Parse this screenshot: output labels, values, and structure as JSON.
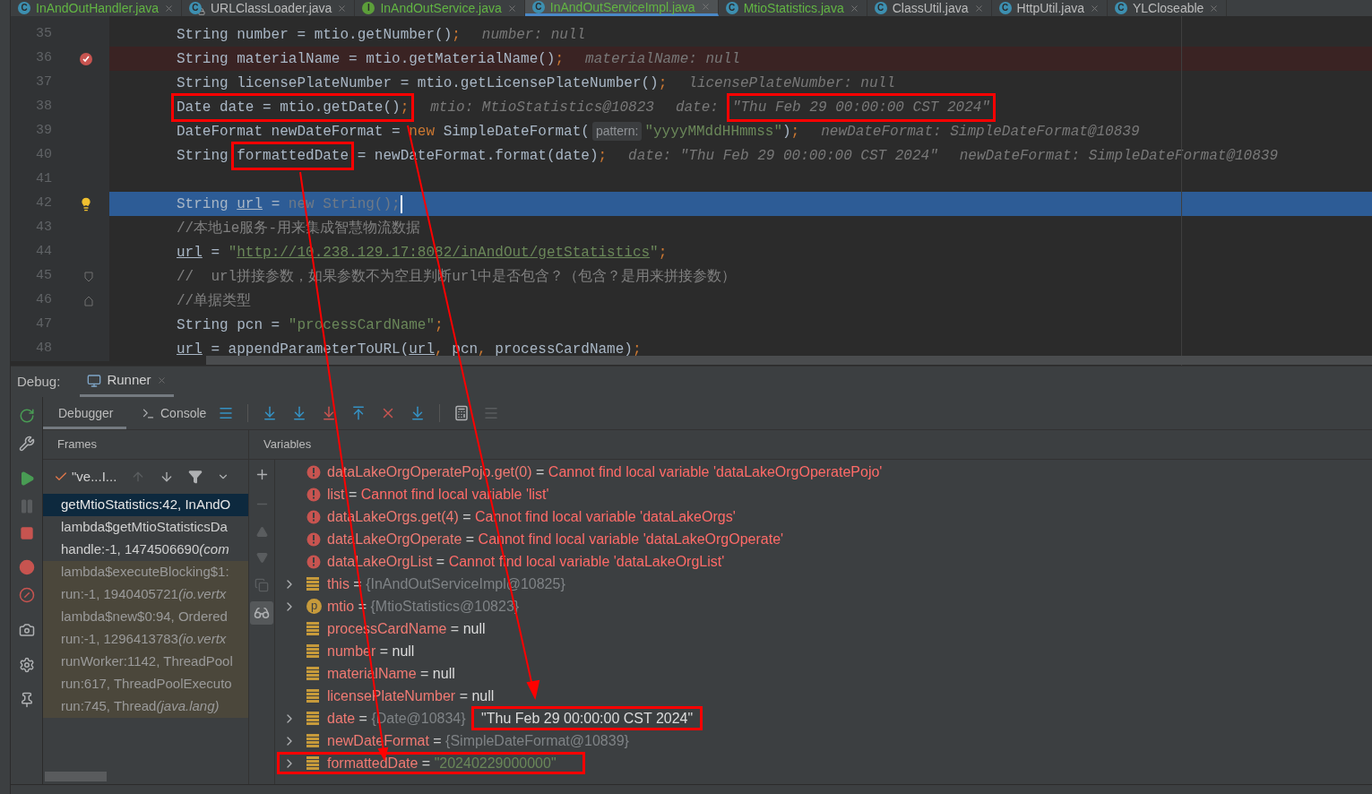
{
  "editor_tabs": [
    {
      "label": "InAndOutHandler.java",
      "kind": "class",
      "icon_letter": "C",
      "modified": true,
      "selected": false
    },
    {
      "label": "URLClassLoader.java",
      "kind": "locked",
      "icon_letter": "C",
      "modified": false,
      "selected": false
    },
    {
      "label": "InAndOutService.java",
      "kind": "interface",
      "icon_letter": "I",
      "modified": true,
      "selected": false
    },
    {
      "label": "InAndOutServiceImpl.java",
      "kind": "class",
      "icon_letter": "C",
      "modified": true,
      "selected": true
    },
    {
      "label": "MtioStatistics.java",
      "kind": "class",
      "icon_letter": "C",
      "modified": true,
      "selected": false
    },
    {
      "label": "ClassUtil.java",
      "kind": "class",
      "icon_letter": "C",
      "modified": false,
      "selected": false
    },
    {
      "label": "HttpUtil.java",
      "kind": "class",
      "icon_letter": "C",
      "modified": false,
      "selected": false
    },
    {
      "label": "YLCloseable",
      "kind": "class",
      "icon_letter": "C",
      "modified": false,
      "selected": false
    }
  ],
  "code_lines": [
    {
      "number": "35",
      "kind": "plain",
      "caret": false,
      "segments": [
        {
          "kind": "code",
          "text": "String number = mtio.getNumber()"
        },
        {
          "kind": "keyword",
          "text": ";"
        },
        {
          "kind": "hint",
          "text": "number: null"
        }
      ]
    },
    {
      "number": "36",
      "kind": "breakpoint",
      "caret": false,
      "segments": [
        {
          "kind": "code",
          "text": "String materialName = mtio.getMaterialName()"
        },
        {
          "kind": "keyword",
          "text": ";"
        },
        {
          "kind": "hint",
          "text": "materialName: null"
        }
      ]
    },
    {
      "number": "37",
      "kind": "plain",
      "caret": false,
      "segments": [
        {
          "kind": "code",
          "text": "String licensePlateNumber = mtio.getLicensePlateNumber()"
        },
        {
          "kind": "keyword",
          "text": ";"
        },
        {
          "kind": "hint",
          "text": "licensePlateNumber: null"
        }
      ]
    },
    {
      "number": "38",
      "kind": "plain",
      "caret": false,
      "segments": [
        {
          "kind": "code",
          "text": "Date date = mtio.getDate()",
          "boxed": true
        },
        {
          "kind": "keyword",
          "text": ";",
          "boxed": true
        },
        {
          "kind": "hint",
          "text": "mtio: MtioStatistics@10823"
        },
        {
          "kind": "hint",
          "text": "date:"
        },
        {
          "kind": "hint_cont",
          "text": "\"Thu Feb 29 00:00:00 CST 2024\"",
          "boxed": true
        }
      ]
    },
    {
      "number": "39",
      "kind": "plain",
      "caret": false,
      "segments": [
        {
          "kind": "code",
          "text": "DateFormat newDateFormat = "
        },
        {
          "kind": "keyword",
          "text": "new"
        },
        {
          "kind": "code",
          "text": " SimpleDateFormat("
        },
        {
          "kind": "param_hint",
          "text": "pattern:"
        },
        {
          "kind": "string",
          "text": "\"yyyyMMddHHmmss\""
        },
        {
          "kind": "code",
          "text": ")"
        },
        {
          "kind": "keyword",
          "text": ";"
        },
        {
          "kind": "hint",
          "text": "newDateFormat: SimpleDateFormat@10839"
        }
      ]
    },
    {
      "number": "40",
      "kind": "plain",
      "caret": false,
      "segments": [
        {
          "kind": "code",
          "text": "String "
        },
        {
          "kind": "code",
          "text": "formattedDate",
          "boxed": true
        },
        {
          "kind": "code",
          "text": " = newDateFormat.format(date)"
        },
        {
          "kind": "keyword",
          "text": ";"
        },
        {
          "kind": "hint",
          "text": "date: \"Thu Feb 29 00:00:00 CST 2024\""
        },
        {
          "kind": "hint",
          "text": "newDateFormat: SimpleDateFormat@10839"
        }
      ]
    },
    {
      "number": "41",
      "kind": "plain",
      "caret": false
    },
    {
      "number": "42",
      "kind": "current",
      "caret": true,
      "segments": [
        {
          "kind": "code",
          "text": "String "
        },
        {
          "kind": "underlined",
          "text": "url"
        },
        {
          "kind": "code",
          "text": " = "
        },
        {
          "kind": "dim",
          "text": "new String();"
        }
      ]
    },
    {
      "number": "43",
      "kind": "plain",
      "caret": false,
      "segments": [
        {
          "kind": "comment",
          "text": "//本地ie服务-用来集成智慧物流数据"
        }
      ]
    },
    {
      "number": "44",
      "kind": "plain",
      "caret": false,
      "segments": [
        {
          "kind": "underlined",
          "text": "url"
        },
        {
          "kind": "code",
          "text": " = "
        },
        {
          "kind": "string",
          "text": "\""
        },
        {
          "kind": "link",
          "text": "http://10.238.129.17:8082/inAndOut/getStatistics"
        },
        {
          "kind": "string",
          "text": "\""
        },
        {
          "kind": "keyword",
          "text": ";"
        }
      ]
    },
    {
      "number": "45",
      "kind": "fold_start",
      "caret": false,
      "segments": [
        {
          "kind": "comment",
          "text": "//  url拼接参数，如果参数不为空且判断url中是否包含？（包含？是用来拼接参数）"
        }
      ]
    },
    {
      "number": "46",
      "kind": "fold_end",
      "caret": false,
      "segments": [
        {
          "kind": "comment",
          "text": "//单据类型"
        }
      ]
    },
    {
      "number": "47",
      "kind": "plain",
      "caret": false,
      "segments": [
        {
          "kind": "code",
          "text": "String pcn = "
        },
        {
          "kind": "string",
          "text": "\"processCardName\""
        },
        {
          "kind": "keyword",
          "text": ";"
        }
      ]
    },
    {
      "number": "48",
      "kind": "plain",
      "caret": false,
      "segments": [
        {
          "kind": "underlined",
          "text": "url"
        },
        {
          "kind": "code",
          "text": " = appendParameterToURL("
        },
        {
          "kind": "underlined",
          "text": "url"
        },
        {
          "kind": "keyword",
          "text": ","
        },
        {
          "kind": "code",
          "text": " pcn"
        },
        {
          "kind": "keyword",
          "text": ","
        },
        {
          "kind": "code",
          "text": " processCardName)"
        },
        {
          "kind": "keyword",
          "text": ";"
        }
      ]
    }
  ],
  "debug": {
    "label": "Debug:",
    "session_tab": {
      "label": "Runner",
      "selected": true
    },
    "tabs": [
      {
        "label": "Debugger",
        "selected": true
      },
      {
        "label": "Console",
        "selected": false
      }
    ],
    "frames_title": "Frames",
    "variables_title": "Variables",
    "thread": "\"ve...I...",
    "frames": [
      {
        "text": "getMtioStatistics:42, InAndO",
        "selected": true,
        "library": false
      },
      {
        "text": "lambda$getMtioStatisticsDa",
        "selected": false,
        "library": false
      },
      {
        "text": "handle:-1, 1474506690 ",
        "detail": "(com",
        "selected": false,
        "library": false
      },
      {
        "text": "lambda$executeBlocking$1:",
        "selected": false,
        "library": true
      },
      {
        "text": "run:-1, 1940405721 ",
        "detail": "(io.vertx",
        "selected": false,
        "library": true
      },
      {
        "text": "lambda$new$0:94, Ordered",
        "selected": false,
        "library": true
      },
      {
        "text": "run:-1, 1296413783 ",
        "detail": "(io.vertx",
        "selected": false,
        "library": true
      },
      {
        "text": "runWorker:1142, ThreadPool",
        "selected": false,
        "library": true
      },
      {
        "text": "run:617, ThreadPoolExecuto",
        "selected": false,
        "library": true
      },
      {
        "text": "run:745, Thread ",
        "detail": "(java.lang)",
        "selected": false,
        "library": true
      }
    ],
    "variables": [
      {
        "kind": "error",
        "name": "dataLakeOrgOperatePojo.get(0)",
        "operator": "=",
        "value": "Cannot find local variable 'dataLakeOrgOperatePojo'",
        "expandable": false
      },
      {
        "kind": "error",
        "name": "list",
        "operator": "=",
        "value": "Cannot find local variable 'list'",
        "expandable": false
      },
      {
        "kind": "error",
        "name": "dataLakeOrgs.get(4)",
        "operator": "=",
        "value": "Cannot find local variable 'dataLakeOrgs'",
        "expandable": false
      },
      {
        "kind": "error",
        "name": "dataLakeOrgOperate",
        "operator": "=",
        "value": "Cannot find local variable 'dataLakeOrgOperate'",
        "expandable": false
      },
      {
        "kind": "error",
        "name": "dataLakeOrgList",
        "operator": "=",
        "value": "Cannot find local variable 'dataLakeOrgList'",
        "expandable": false
      },
      {
        "kind": "field",
        "name": "this",
        "operator": "=",
        "ref": "{InAndOutServiceImpl@10825}",
        "expandable": true
      },
      {
        "kind": "param",
        "badge": "p",
        "name": "mtio",
        "operator": "=",
        "ref": "{MtioStatistics@10823}",
        "expandable": true
      },
      {
        "kind": "field",
        "name": "processCardName",
        "operator": "=",
        "value": "null",
        "expandable": false
      },
      {
        "kind": "field",
        "name": "number",
        "operator": "=",
        "value": "null",
        "expandable": false
      },
      {
        "kind": "field",
        "name": "materialName",
        "operator": "=",
        "value": "null",
        "expandable": false
      },
      {
        "kind": "field",
        "name": "licensePlateNumber",
        "operator": "=",
        "value": "null",
        "expandable": false
      },
      {
        "kind": "field",
        "name": "date",
        "operator": "=",
        "ref": "{Date@10834}",
        "value": "\"Thu Feb 29 00:00:00 CST 2024\"",
        "boxed": true,
        "expandable": true
      },
      {
        "kind": "field",
        "name": "newDateFormat",
        "operator": "=",
        "ref": "{SimpleDateFormat@10839}",
        "expandable": true
      },
      {
        "kind": "field_string",
        "name": "formattedDate",
        "operator": "=",
        "value": "\"20240229000000\"",
        "boxed": true,
        "expandable": true
      }
    ]
  }
}
